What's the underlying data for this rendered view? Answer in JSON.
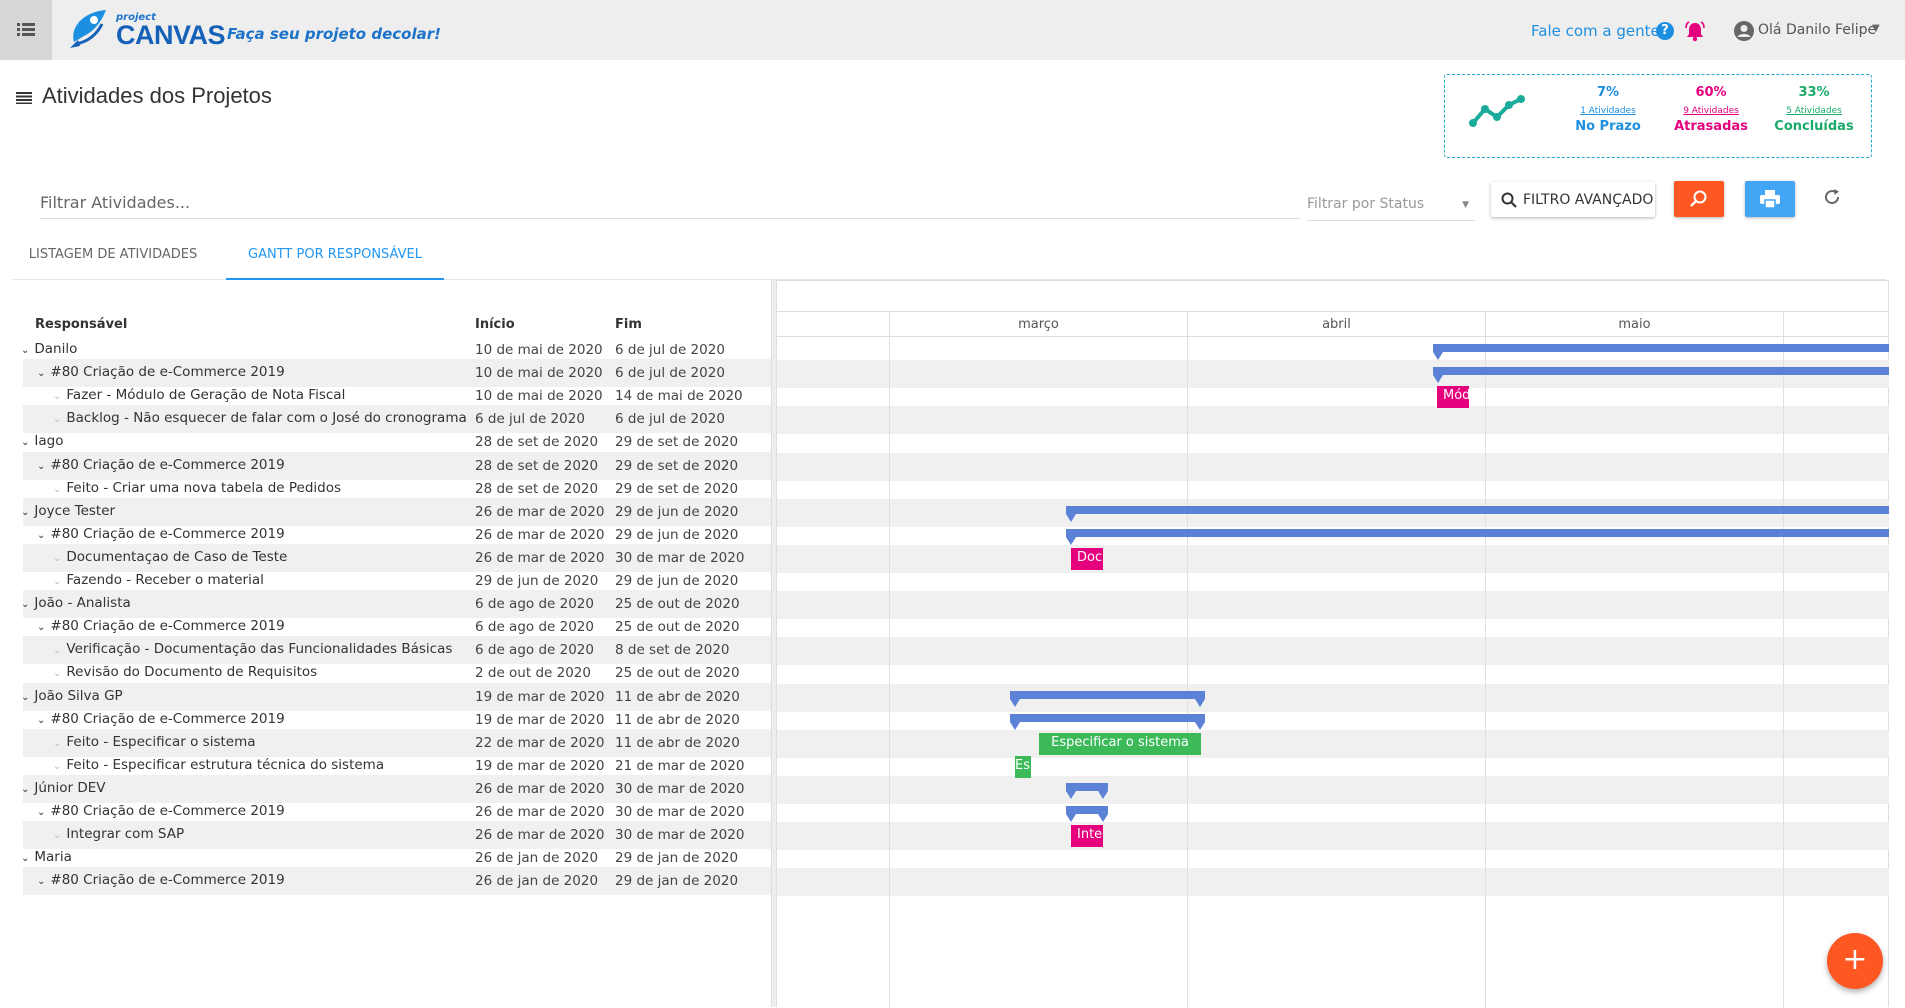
{
  "app": {
    "logo_project": "project",
    "logo_name": "CANVAS",
    "slogan": "Faça seu projeto decolar!",
    "contact": "Fale com a gente",
    "user_greeting": "Olá Danilo Felipe"
  },
  "page": {
    "title": "Atividades dos Projetos"
  },
  "stats": [
    {
      "pct": "7%",
      "count": "1 Atividades",
      "label": "No Prazo",
      "color": "#1d8fe0"
    },
    {
      "pct": "60%",
      "count": "9 Atividades",
      "label": "Atrasadas",
      "color": "#e5007e"
    },
    {
      "pct": "33%",
      "count": "5 Atividades",
      "label": "Concluídas",
      "color": "#1aab6b"
    }
  ],
  "filters": {
    "search_placeholder": "Filtrar Atividades...",
    "status_placeholder": "Filtrar por Status",
    "advanced_label": "FILTRO AVANÇADO"
  },
  "tabs": [
    {
      "label": "LISTAGEM DE ATIVIDADES",
      "active": false
    },
    {
      "label": "GANTT POR RESPONSÁVEL",
      "active": true
    }
  ],
  "table": {
    "col_responsavel": "Responsável",
    "col_inicio": "Início",
    "col_fim": "Fim"
  },
  "months": [
    "março",
    "abril",
    "maio"
  ],
  "rows": [
    {
      "level": 0,
      "name": "Danilo",
      "start": "10 de mai de 2020",
      "end": "6 de jul de 2020"
    },
    {
      "level": 1,
      "name": "#80 Criação de e-Commerce 2019",
      "start": "10 de mai de 2020",
      "end": "6 de jul de 2020"
    },
    {
      "level": 2,
      "name": "Fazer - Módulo de Geração de Nota Fiscal",
      "start": "10 de mai de 2020",
      "end": "14 de mai de 2020"
    },
    {
      "level": 2,
      "name": "Backlog - Não esquecer de falar com o José do cronograma",
      "start": "6 de jul de 2020",
      "end": "6 de jul de 2020"
    },
    {
      "level": 0,
      "name": "Iago",
      "start": "28 de set de 2020",
      "end": "29 de set de 2020"
    },
    {
      "level": 1,
      "name": "#80 Criação de e-Commerce 2019",
      "start": "28 de set de 2020",
      "end": "29 de set de 2020"
    },
    {
      "level": 2,
      "name": "Feito - Criar uma nova tabela de Pedidos",
      "start": "28 de set de 2020",
      "end": "29 de set de 2020"
    },
    {
      "level": 0,
      "name": "Joyce Tester",
      "start": "26 de mar de 2020",
      "end": "29 de jun de 2020"
    },
    {
      "level": 1,
      "name": "#80 Criação de e-Commerce 2019",
      "start": "26 de mar de 2020",
      "end": "29 de jun de 2020"
    },
    {
      "level": 2,
      "name": "Documentaçao de Caso de Teste",
      "start": "26 de mar de 2020",
      "end": "30 de mar de 2020"
    },
    {
      "level": 2,
      "name": "Fazendo - Receber o material",
      "start": "29 de jun de 2020",
      "end": "29 de jun de 2020"
    },
    {
      "level": 0,
      "name": "João - Analista",
      "start": "6 de ago de 2020",
      "end": "25 de out de 2020"
    },
    {
      "level": 1,
      "name": "#80 Criação de e-Commerce 2019",
      "start": "6 de ago de 2020",
      "end": "25 de out de 2020"
    },
    {
      "level": 2,
      "name": "Verificação - Documentação das Funcionalidades Básicas",
      "start": "6 de ago de 2020",
      "end": "8 de set de 2020"
    },
    {
      "level": 2,
      "name": "Revisão do Documento de Requisitos",
      "start": "2 de out de 2020",
      "end": "25 de out de 2020"
    },
    {
      "level": 0,
      "name": "João Silva GP",
      "start": "19 de mar de 2020",
      "end": "11 de abr de 2020"
    },
    {
      "level": 1,
      "name": "#80 Criação de e-Commerce 2019",
      "start": "19 de mar de 2020",
      "end": "11 de abr de 2020"
    },
    {
      "level": 2,
      "name": "Feito - Especificar o sistema",
      "start": "22 de mar de 2020",
      "end": "11 de abr de 2020"
    },
    {
      "level": 2,
      "name": "Feito - Especificar estrutura técnica do sistema",
      "start": "19 de mar de 2020",
      "end": "21 de mar de 2020"
    },
    {
      "level": 0,
      "name": "Júnior DEV",
      "start": "26 de mar de 2020",
      "end": "30 de mar de 2020"
    },
    {
      "level": 1,
      "name": "#80 Criação de e-Commerce 2019",
      "start": "26 de mar de 2020",
      "end": "30 de mar de 2020"
    },
    {
      "level": 2,
      "name": "Integrar com SAP",
      "start": "26 de mar de 2020",
      "end": "30 de mar de 2020"
    },
    {
      "level": 0,
      "name": "Maria",
      "start": "26 de jan de 2020",
      "end": "29 de jan de 2020"
    },
    {
      "level": 1,
      "name": "#80 Criação de e-Commerce 2019",
      "start": "26 de jan de 2020",
      "end": "29 de jan de 2020"
    }
  ],
  "gantt_tasks": [
    {
      "label": "Módulo de Geração de Nota Fiscal",
      "color": "#e5007e"
    },
    {
      "label": "Documentaçao de Caso de Teste",
      "color": "#e5007e"
    },
    {
      "label": "Especificar o sistema",
      "color": "#3cba5a"
    },
    {
      "label": "Especificar estrutura técnica do sistema",
      "color": "#3cba5a"
    },
    {
      "label": "Integrar com SAP",
      "color": "#e5007e"
    }
  ],
  "fab_label": "+"
}
